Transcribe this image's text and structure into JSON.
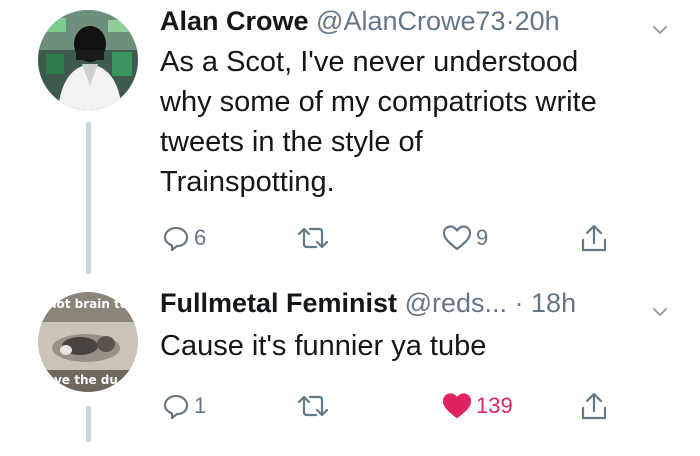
{
  "tweets": [
    {
      "name": "Alan Crowe",
      "handle": "@AlanCrowe73",
      "separator": "·",
      "time": "20h",
      "text_lines": [
        "As a Scot, I've never understood",
        "why some of my compatriots write",
        "tweets in the style of",
        "Trainspotting."
      ],
      "reply_count": "6",
      "retweet_count": "",
      "like_count": "9",
      "liked": false
    },
    {
      "name": "Fullmetal Feminist",
      "handle": "@reds...",
      "separator": "·",
      "time": "18h",
      "avatar_caption_top": "not brain to",
      "avatar_caption_bottom": "ve the du",
      "text_lines": [
        "Cause it's funnier ya tube"
      ],
      "reply_count": "1",
      "retweet_count": "",
      "like_count": "139",
      "liked": true
    }
  ],
  "colors": {
    "text": "#14171a",
    "secondary": "#657786",
    "like": "#e0245e",
    "thread_line": "#ccd6dd"
  },
  "icons": [
    "reply-icon",
    "retweet-icon",
    "like-icon",
    "share-icon",
    "chevron-down-icon"
  ]
}
